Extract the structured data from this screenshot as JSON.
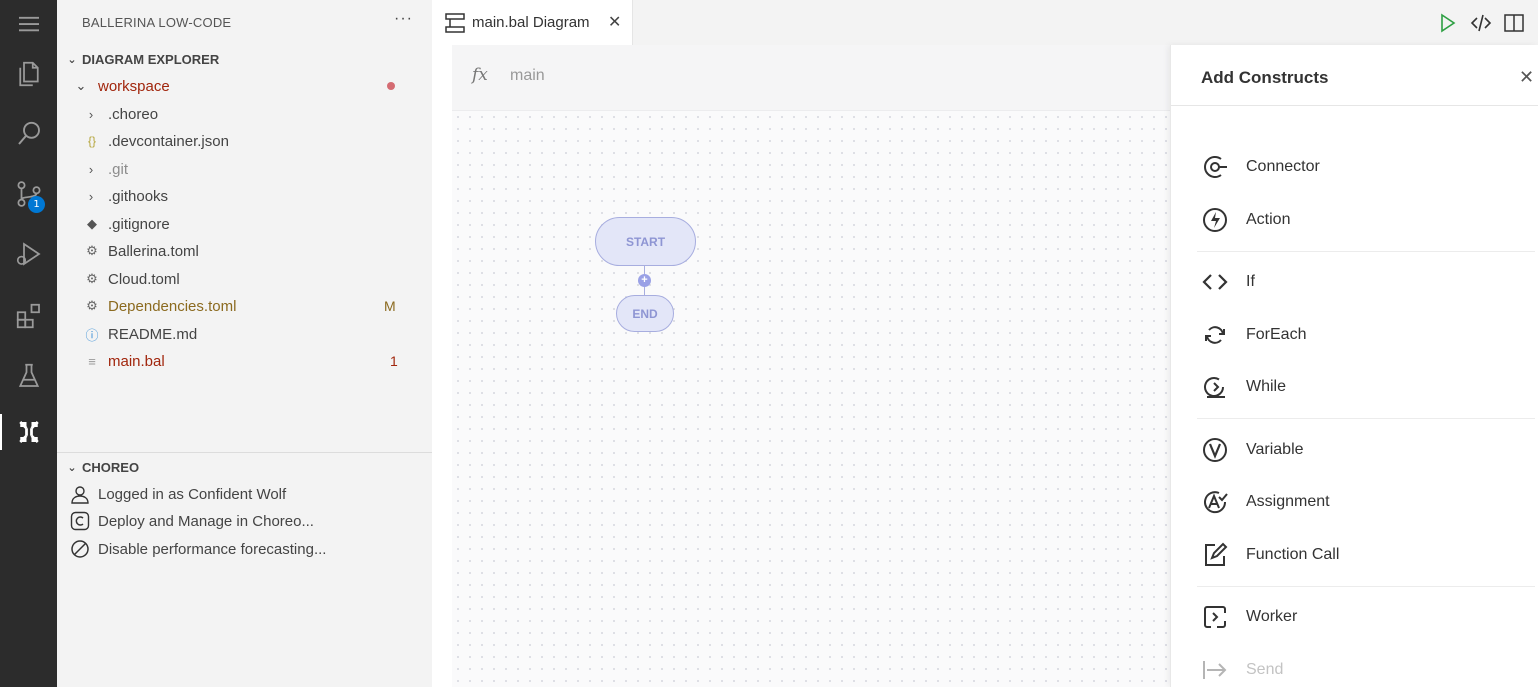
{
  "activity_bar": {
    "items": [
      "menu-icon",
      "explorer-icon",
      "search-icon",
      "source-control-icon",
      "run-debug-icon",
      "extensions-icon",
      "testing-icon",
      "choreo-icon"
    ],
    "source_control_badge": "1"
  },
  "sidebar": {
    "header": "BALLERINA LOW-CODE",
    "more": "···",
    "explorer_title": "DIAGRAM EXPLORER",
    "workspace": "workspace",
    "files": [
      {
        "name": ".choreo",
        "icon": "chevron-right",
        "color": "#444444",
        "decoration": ""
      },
      {
        "name": ".devcontainer.json",
        "icon": "json-icon",
        "color": "#444444",
        "decoration": ""
      },
      {
        "name": ".git",
        "icon": "chevron-right",
        "color": "#8c8c8c",
        "decoration": ""
      },
      {
        "name": ".githooks",
        "icon": "chevron-right",
        "color": "#444444",
        "decoration": ""
      },
      {
        "name": ".gitignore",
        "icon": "git-icon",
        "color": "#444444",
        "decoration": ""
      },
      {
        "name": "Ballerina.toml",
        "icon": "gear-icon",
        "color": "#444444",
        "decoration": ""
      },
      {
        "name": "Cloud.toml",
        "icon": "gear-icon",
        "color": "#444444",
        "decoration": ""
      },
      {
        "name": "Dependencies.toml",
        "icon": "gear-icon",
        "color": "#8b6a1f",
        "decoration": "M"
      },
      {
        "name": "README.md",
        "icon": "info-icon",
        "color": "#444444",
        "decoration": ""
      },
      {
        "name": "main.bal",
        "icon": "lines-icon",
        "color": "#a1260d",
        "decoration": "1"
      }
    ],
    "choreo_title": "CHOREO",
    "choreo_items": [
      {
        "label": "Logged in as Confident Wolf",
        "icon": "account-icon"
      },
      {
        "label": "Deploy and Manage in Choreo...",
        "icon": "choreo-c-icon"
      },
      {
        "label": "Disable performance forecasting...",
        "icon": "disable-icon"
      }
    ]
  },
  "editor": {
    "tab_label": "main.bal Diagram",
    "tab_close": "✕",
    "function_keyword": "fx",
    "function_name": "main",
    "start_label": "START",
    "end_label": "END",
    "plus": "+"
  },
  "panel": {
    "title": "Add Constructs",
    "close": "✕",
    "constructs": [
      {
        "label": "Connector",
        "icon": "connector-icon"
      },
      {
        "label": "Action",
        "icon": "action-icon"
      },
      {
        "label": "If",
        "icon": "if-icon"
      },
      {
        "label": "ForEach",
        "icon": "foreach-icon"
      },
      {
        "label": "While",
        "icon": "while-icon"
      },
      {
        "label": "Variable",
        "icon": "variable-icon"
      },
      {
        "label": "Assignment",
        "icon": "assignment-icon"
      },
      {
        "label": "Function Call",
        "icon": "function-call-icon"
      },
      {
        "label": "Worker",
        "icon": "worker-icon"
      },
      {
        "label": "Send",
        "icon": "send-icon",
        "disabled": true
      }
    ]
  },
  "colors": {
    "activity_bar": "#2c2c2c",
    "sidebar": "#f3f3f3",
    "badge": "#0078d4",
    "node_fill": "#e3e6f8",
    "node_stroke": "#a7addf",
    "run_green": "#2ea043"
  }
}
